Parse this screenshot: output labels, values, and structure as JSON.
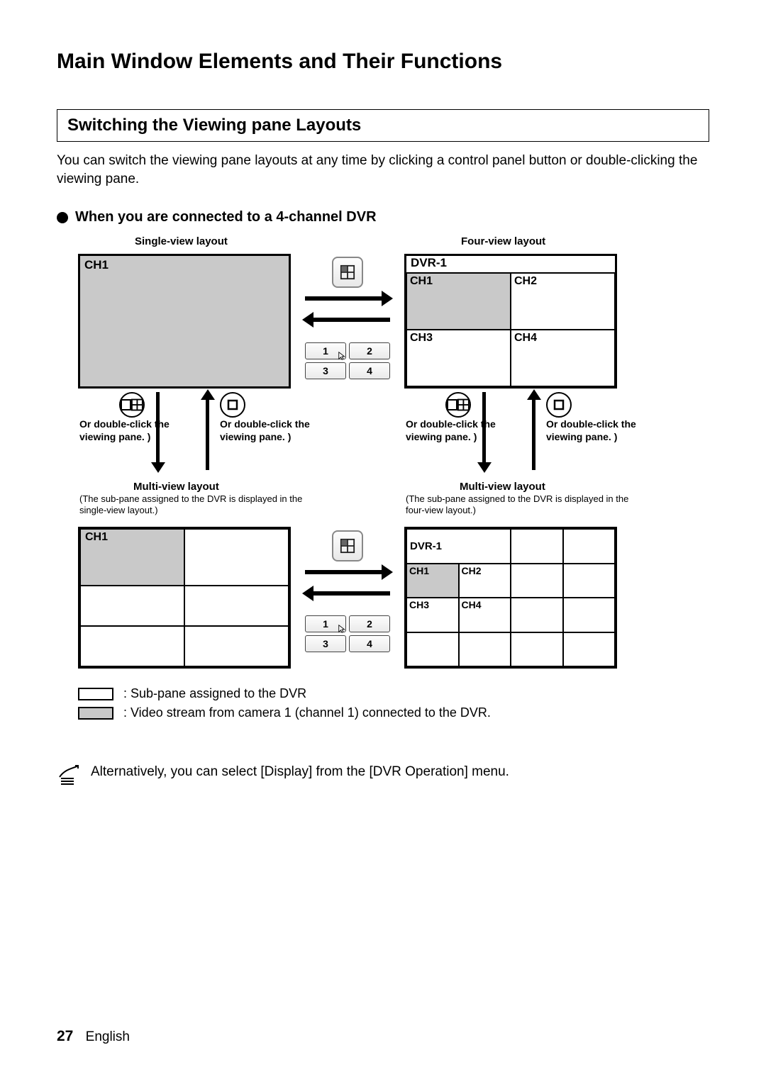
{
  "title": "Main Window Elements and Their Functions",
  "section_heading": "Switching the Viewing pane Layouts",
  "intro": "You can switch the viewing pane layouts at any time by clicking a control panel button or double-clicking the viewing pane.",
  "subheading": "When you are connected to a 4-channel DVR",
  "labels": {
    "single_view": "Single-view layout",
    "four_view": "Four-view layout",
    "multi_view": "Multi-view layout",
    "multi_sub_single": "(The sub-pane assigned to the DVR is displayed in the single-view layout.)",
    "multi_sub_four": "(The sub-pane assigned to the DVR is displayed in the four-view layout.)",
    "dblclick": "Or double-click the viewing pane. )"
  },
  "panes": {
    "single": "CH1",
    "four_title": "DVR-1",
    "ch1": "CH1",
    "ch2": "CH2",
    "ch3": "CH3",
    "ch4": "CH4",
    "multir_title": "DVR-1"
  },
  "selector": {
    "n1": "1",
    "n2": "2",
    "n3": "3",
    "n4": "4"
  },
  "legend": {
    "row1": ": Sub-pane assigned to the DVR",
    "row2": ": Video stream from camera 1 (channel 1) connected to the DVR."
  },
  "note": "Alternatively, you can select [Display] from the [DVR Operation] menu.",
  "footer": {
    "page": "27",
    "lang": "English"
  }
}
